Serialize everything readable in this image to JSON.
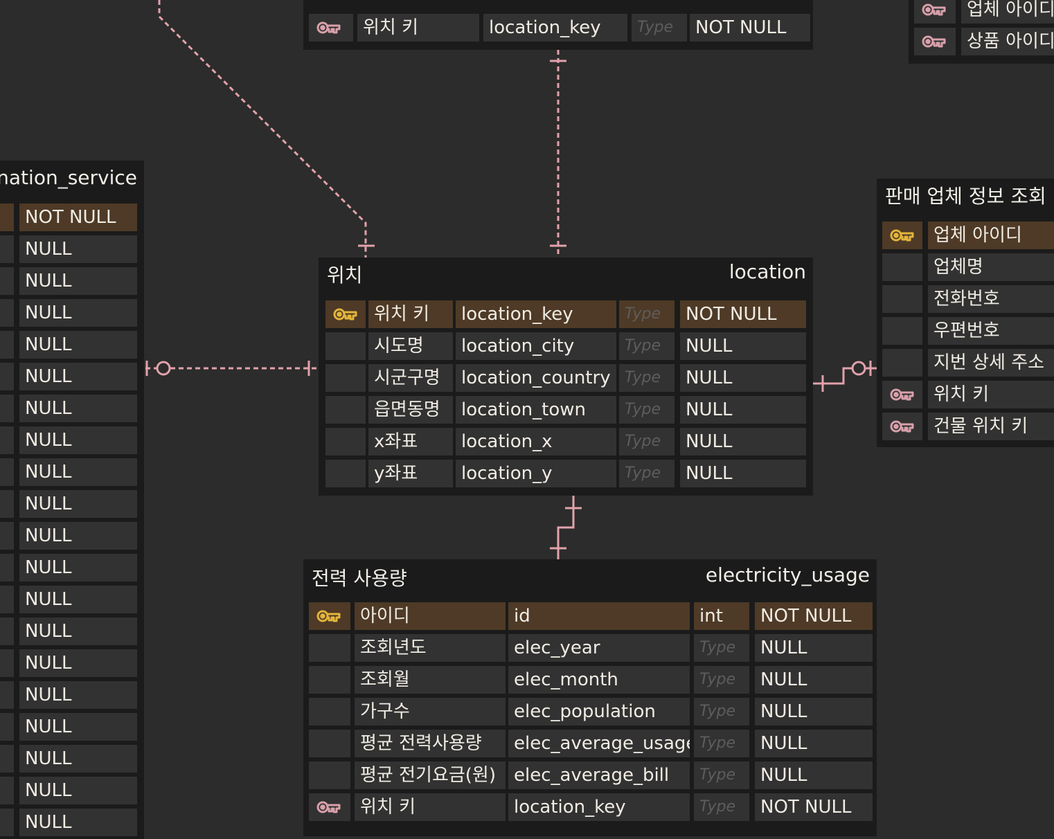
{
  "colors": {
    "background": "#2c2c2c",
    "table_bg": "#1b1b1b",
    "cell_bg": "#323232",
    "pk_row_bg": "#4e3a26",
    "primary_key_icon": "#e3b53b",
    "foreign_key_icon": "#d9a0aa",
    "relation_line": "#e2a2ac"
  },
  "tables": {
    "top_partial": {
      "rows": [
        {
          "kor": "위치 키",
          "eng": "location_key",
          "type": "Type",
          "nullability": "NOT NULL",
          "icon": "foreign-key-icon"
        }
      ]
    },
    "top_right_partial": {
      "rows": [
        {
          "kor": "업체 아이디",
          "icon": "foreign-key-icon"
        },
        {
          "kor": "상품 아이디",
          "icon": "foreign-key-icon"
        }
      ]
    },
    "left_partial": {
      "header_fragment": "nation_service",
      "nullability": [
        "NOT NULL",
        "NULL",
        "NULL",
        "NULL",
        "NULL",
        "NULL",
        "NULL",
        "NULL",
        "NULL",
        "NULL",
        "NULL",
        "NULL",
        "NULL",
        "NULL",
        "NULL",
        "NULL",
        "NULL",
        "NULL",
        "NULL",
        "NULL"
      ]
    },
    "location": {
      "title_kor": "위치",
      "title_eng": "location",
      "rows": [
        {
          "kor": "위치 키",
          "eng": "location_key",
          "type": "Type",
          "nullability": "NOT NULL",
          "icon": "primary-key-icon"
        },
        {
          "kor": "시도명",
          "eng": "location_city",
          "type": "Type",
          "nullability": "NULL",
          "icon": ""
        },
        {
          "kor": "시군구명",
          "eng": "location_country",
          "type": "Type",
          "nullability": "NULL",
          "icon": ""
        },
        {
          "kor": "읍면동명",
          "eng": "location_town",
          "type": "Type",
          "nullability": "NULL",
          "icon": ""
        },
        {
          "kor": "x좌표",
          "eng": "location_x",
          "type": "Type",
          "nullability": "NULL",
          "icon": ""
        },
        {
          "kor": "y좌표",
          "eng": "location_y",
          "type": "Type",
          "nullability": "NULL",
          "icon": ""
        }
      ]
    },
    "vendor": {
      "title_kor": "판매 업체 정보 조회",
      "rows": [
        {
          "kor": "업체 아이디",
          "icon": "primary-key-icon"
        },
        {
          "kor": "업체명",
          "icon": ""
        },
        {
          "kor": "전화번호",
          "icon": ""
        },
        {
          "kor": "우편번호",
          "icon": ""
        },
        {
          "kor": "지번 상세 주소",
          "icon": ""
        },
        {
          "kor": "위치 키",
          "icon": "foreign-key-icon"
        },
        {
          "kor": "건물 위치 키",
          "icon": "foreign-key-icon"
        }
      ]
    },
    "electricity_usage": {
      "title_kor": "전력 사용량",
      "title_eng": "electricity_usage",
      "rows": [
        {
          "kor": "아이디",
          "eng": "id",
          "type": "int",
          "nullability": "NOT NULL",
          "icon": "primary-key-icon"
        },
        {
          "kor": "조회년도",
          "eng": "elec_year",
          "type": "Type",
          "nullability": "NULL",
          "icon": ""
        },
        {
          "kor": "조회월",
          "eng": "elec_month",
          "type": "Type",
          "nullability": "NULL",
          "icon": ""
        },
        {
          "kor": "가구수",
          "eng": "elec_population",
          "type": "Type",
          "nullability": "NULL",
          "icon": ""
        },
        {
          "kor": "평균 전력사용량",
          "eng": "elec_average_usage",
          "type": "Type",
          "nullability": "NULL",
          "icon": ""
        },
        {
          "kor": "평균 전기요금(원)",
          "eng": "elec_average_bill",
          "type": "Type",
          "nullability": "NULL",
          "icon": ""
        },
        {
          "kor": "위치 키",
          "eng": "location_key",
          "type": "Type",
          "nullability": "NOT NULL",
          "icon": "foreign-key-icon"
        }
      ]
    }
  }
}
